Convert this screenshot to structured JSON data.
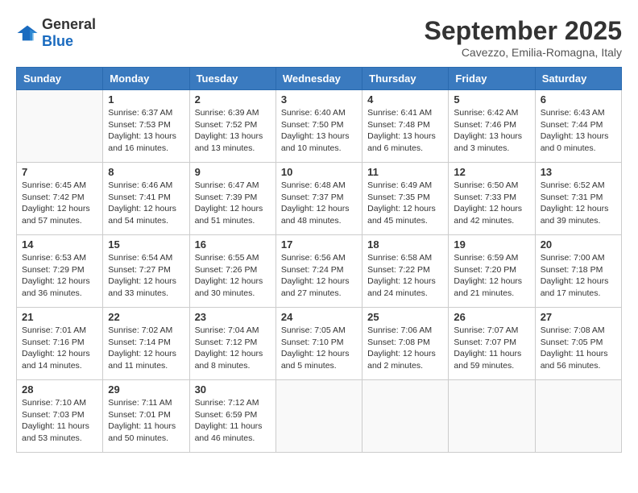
{
  "header": {
    "logo_general": "General",
    "logo_blue": "Blue",
    "month": "September 2025",
    "location": "Cavezzo, Emilia-Romagna, Italy"
  },
  "weekdays": [
    "Sunday",
    "Monday",
    "Tuesday",
    "Wednesday",
    "Thursday",
    "Friday",
    "Saturday"
  ],
  "weeks": [
    [
      {
        "day": "",
        "info": ""
      },
      {
        "day": "1",
        "info": "Sunrise: 6:37 AM\nSunset: 7:53 PM\nDaylight: 13 hours\nand 16 minutes."
      },
      {
        "day": "2",
        "info": "Sunrise: 6:39 AM\nSunset: 7:52 PM\nDaylight: 13 hours\nand 13 minutes."
      },
      {
        "day": "3",
        "info": "Sunrise: 6:40 AM\nSunset: 7:50 PM\nDaylight: 13 hours\nand 10 minutes."
      },
      {
        "day": "4",
        "info": "Sunrise: 6:41 AM\nSunset: 7:48 PM\nDaylight: 13 hours\nand 6 minutes."
      },
      {
        "day": "5",
        "info": "Sunrise: 6:42 AM\nSunset: 7:46 PM\nDaylight: 13 hours\nand 3 minutes."
      },
      {
        "day": "6",
        "info": "Sunrise: 6:43 AM\nSunset: 7:44 PM\nDaylight: 13 hours\nand 0 minutes."
      }
    ],
    [
      {
        "day": "7",
        "info": "Sunrise: 6:45 AM\nSunset: 7:42 PM\nDaylight: 12 hours\nand 57 minutes."
      },
      {
        "day": "8",
        "info": "Sunrise: 6:46 AM\nSunset: 7:41 PM\nDaylight: 12 hours\nand 54 minutes."
      },
      {
        "day": "9",
        "info": "Sunrise: 6:47 AM\nSunset: 7:39 PM\nDaylight: 12 hours\nand 51 minutes."
      },
      {
        "day": "10",
        "info": "Sunrise: 6:48 AM\nSunset: 7:37 PM\nDaylight: 12 hours\nand 48 minutes."
      },
      {
        "day": "11",
        "info": "Sunrise: 6:49 AM\nSunset: 7:35 PM\nDaylight: 12 hours\nand 45 minutes."
      },
      {
        "day": "12",
        "info": "Sunrise: 6:50 AM\nSunset: 7:33 PM\nDaylight: 12 hours\nand 42 minutes."
      },
      {
        "day": "13",
        "info": "Sunrise: 6:52 AM\nSunset: 7:31 PM\nDaylight: 12 hours\nand 39 minutes."
      }
    ],
    [
      {
        "day": "14",
        "info": "Sunrise: 6:53 AM\nSunset: 7:29 PM\nDaylight: 12 hours\nand 36 minutes."
      },
      {
        "day": "15",
        "info": "Sunrise: 6:54 AM\nSunset: 7:27 PM\nDaylight: 12 hours\nand 33 minutes."
      },
      {
        "day": "16",
        "info": "Sunrise: 6:55 AM\nSunset: 7:26 PM\nDaylight: 12 hours\nand 30 minutes."
      },
      {
        "day": "17",
        "info": "Sunrise: 6:56 AM\nSunset: 7:24 PM\nDaylight: 12 hours\nand 27 minutes."
      },
      {
        "day": "18",
        "info": "Sunrise: 6:58 AM\nSunset: 7:22 PM\nDaylight: 12 hours\nand 24 minutes."
      },
      {
        "day": "19",
        "info": "Sunrise: 6:59 AM\nSunset: 7:20 PM\nDaylight: 12 hours\nand 21 minutes."
      },
      {
        "day": "20",
        "info": "Sunrise: 7:00 AM\nSunset: 7:18 PM\nDaylight: 12 hours\nand 17 minutes."
      }
    ],
    [
      {
        "day": "21",
        "info": "Sunrise: 7:01 AM\nSunset: 7:16 PM\nDaylight: 12 hours\nand 14 minutes."
      },
      {
        "day": "22",
        "info": "Sunrise: 7:02 AM\nSunset: 7:14 PM\nDaylight: 12 hours\nand 11 minutes."
      },
      {
        "day": "23",
        "info": "Sunrise: 7:04 AM\nSunset: 7:12 PM\nDaylight: 12 hours\nand 8 minutes."
      },
      {
        "day": "24",
        "info": "Sunrise: 7:05 AM\nSunset: 7:10 PM\nDaylight: 12 hours\nand 5 minutes."
      },
      {
        "day": "25",
        "info": "Sunrise: 7:06 AM\nSunset: 7:08 PM\nDaylight: 12 hours\nand 2 minutes."
      },
      {
        "day": "26",
        "info": "Sunrise: 7:07 AM\nSunset: 7:07 PM\nDaylight: 11 hours\nand 59 minutes."
      },
      {
        "day": "27",
        "info": "Sunrise: 7:08 AM\nSunset: 7:05 PM\nDaylight: 11 hours\nand 56 minutes."
      }
    ],
    [
      {
        "day": "28",
        "info": "Sunrise: 7:10 AM\nSunset: 7:03 PM\nDaylight: 11 hours\nand 53 minutes."
      },
      {
        "day": "29",
        "info": "Sunrise: 7:11 AM\nSunset: 7:01 PM\nDaylight: 11 hours\nand 50 minutes."
      },
      {
        "day": "30",
        "info": "Sunrise: 7:12 AM\nSunset: 6:59 PM\nDaylight: 11 hours\nand 46 minutes."
      },
      {
        "day": "",
        "info": ""
      },
      {
        "day": "",
        "info": ""
      },
      {
        "day": "",
        "info": ""
      },
      {
        "day": "",
        "info": ""
      }
    ]
  ]
}
